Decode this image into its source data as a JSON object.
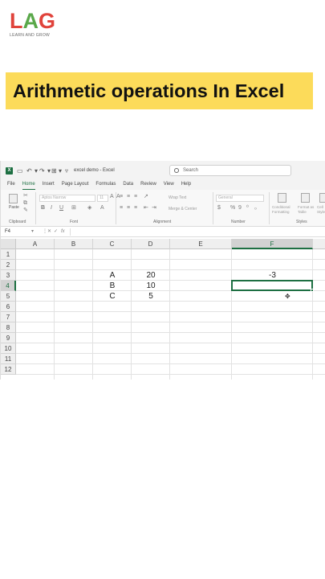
{
  "logo": {
    "letters": [
      "L",
      "A",
      "G"
    ],
    "tagline": "LEARN AND GROW"
  },
  "banner": {
    "title": "Arithmetic operations In Excel"
  },
  "excel": {
    "titlebar": {
      "doc_name": "excel demo  -  Excel",
      "search_placeholder": "Search"
    },
    "menu": [
      "File",
      "Home",
      "Insert",
      "Page Layout",
      "Formulas",
      "Data",
      "Review",
      "View",
      "Help"
    ],
    "active_menu": "Home",
    "ribbon": {
      "paste_label": "Paste",
      "font_name": "Aptos Narrow",
      "font_size": "11",
      "wrap_text": "Wrap Text",
      "merge_center": "Merge & Center",
      "number_format": "General",
      "conditional_formatting": "Conditional Formatting",
      "format_as_table": "Format as Table",
      "cell_styles": "Cell Styles",
      "groups": {
        "clipboard": "Clipboard",
        "font": "Font",
        "alignment": "Alignment",
        "number": "Number",
        "styles": "Styles"
      }
    },
    "formula_bar": {
      "name_box": "F4",
      "fx": "fx",
      "value": ""
    },
    "columns": [
      "A",
      "B",
      "C",
      "D",
      "E",
      "F"
    ],
    "selected_column": "F",
    "rows": [
      "1",
      "2",
      "3",
      "4",
      "5",
      "6",
      "7",
      "8",
      "9",
      "10",
      "11",
      "12"
    ],
    "selected_row": "4",
    "cells": {
      "C3": "A",
      "D3": "20",
      "F3": "-3",
      "C4": "B",
      "D4": "10",
      "C5": "C",
      "D5": "5"
    },
    "active_cell": "F4"
  },
  "colors": {
    "excel_green": "#1d6f42",
    "banner_yellow": "#fcdb5a",
    "logo_red": "#e0433b",
    "logo_green": "#5aa84a"
  }
}
